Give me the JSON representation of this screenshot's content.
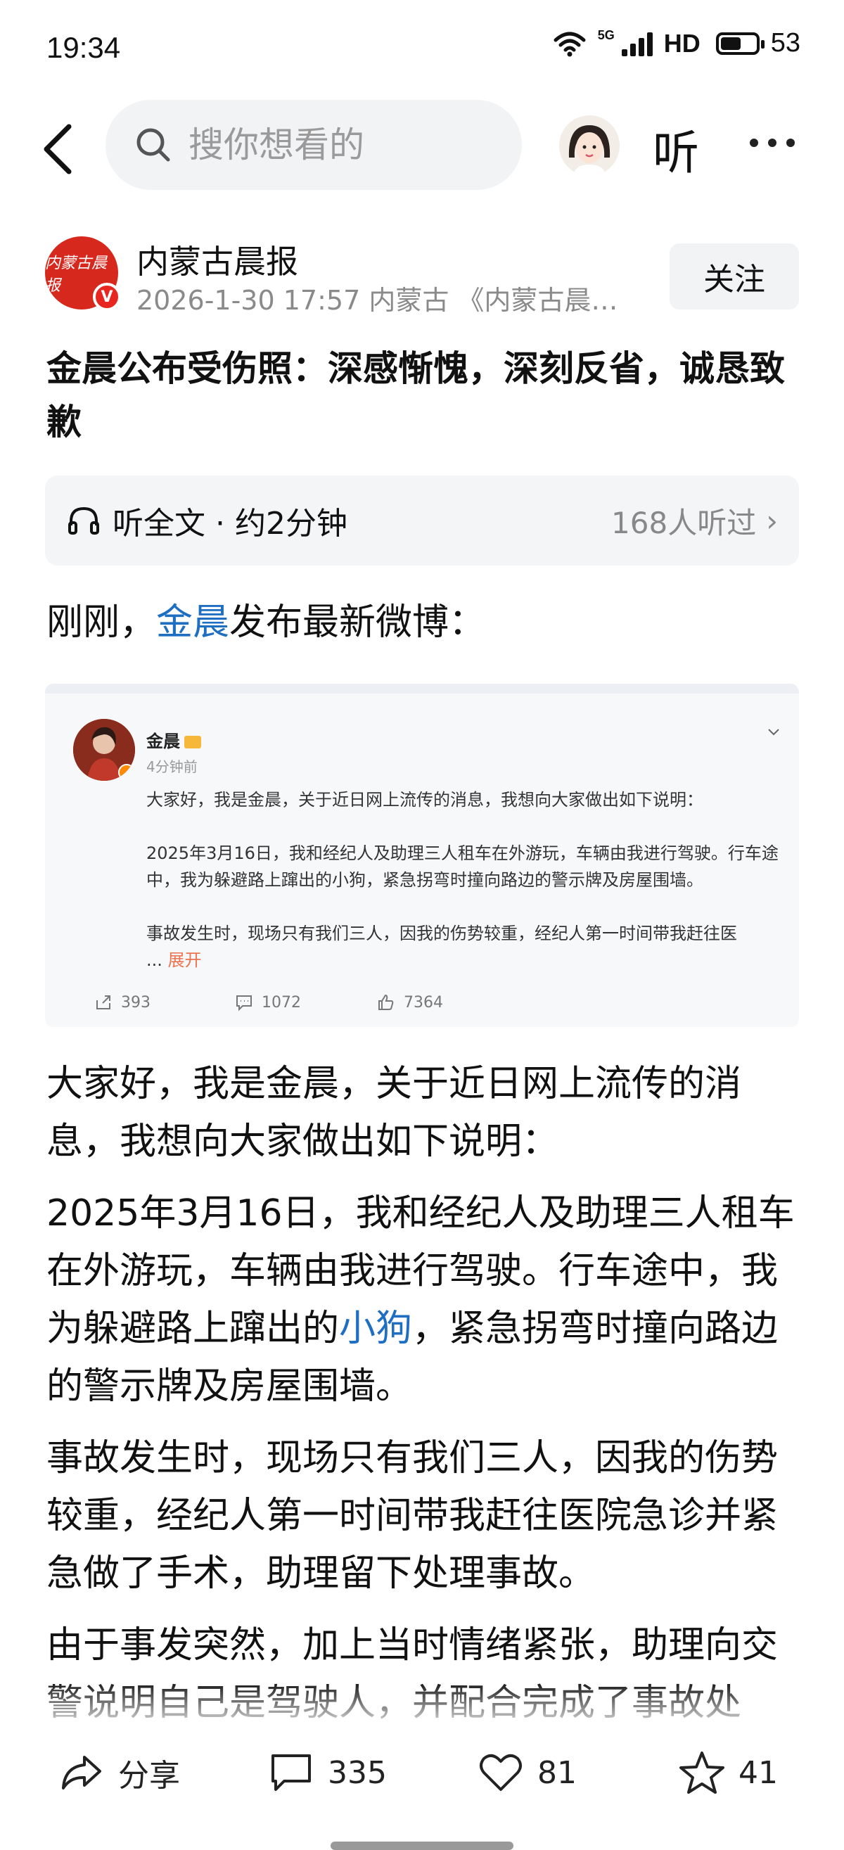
{
  "status_bar": {
    "time": "19:34",
    "network": "5G",
    "hd": "HD",
    "battery": "53",
    "battery_level_percent": 53,
    "icons": [
      "wifi-icon",
      "signal-icon",
      "battery-icon"
    ]
  },
  "nav": {
    "back_icon": "chevron-left-icon",
    "search_placeholder": "搜你想看的",
    "listen_label": "听",
    "more_icon": "more-dots-icon"
  },
  "author": {
    "name": "内蒙古晨报",
    "logo_text": "内蒙古晨报",
    "verified_mark": "V",
    "meta": "2026-1-30  17:57  内蒙古  《内蒙古晨报…",
    "follow_label": "关注"
  },
  "article": {
    "title": "金晨公布受伤照：深感惭愧，深刻反省，诚恳致歉",
    "listen_bar": {
      "label": "听全文 · 约2分钟",
      "count": "168人听过",
      "chevron": "›"
    },
    "intro_prefix": "刚刚，",
    "intro_link": "金晨",
    "intro_suffix": "发布最新微博：",
    "paragraph_1": "大家好，我是金晨，关于近日网上流传的消息，我想向大家做出如下说明：",
    "paragraph_2_before": "2025年3月16日，我和经纪人及助理三人租车在外游玩，车辆由我进行驾驶。行车途中，我为躲避路上蹿出的",
    "paragraph_2_link": "小狗",
    "paragraph_2_after": "，紧急拐弯时撞向路边的警示牌及房屋围墙。",
    "paragraph_3": "事故发生时，现场只有我们三人，因我的伤势较重，经纪人第一时间带我赶往医院急诊并紧急做了手术，助理留下处理事故。",
    "paragraph_4": "由于事发突然，加上当时情绪紧张，助理向交警说明自己是驾驶人，并配合完成了事故处"
  },
  "weibo_card": {
    "name": "金晨",
    "time": "4分钟前",
    "line_1": "大家好，我是金晨，关于近日网上流传的消息，我想向大家做出如下说明：",
    "line_2": "2025年3月16日，我和经纪人及助理三人租车在外游玩，车辆由我进行驾驶。行车途中，我为躲避路上蹿出的小狗，紧急拐弯时撞向路边的警示牌及房屋围墙。",
    "line_3": "事故发生时，现场只有我们三人，因我的伤势较重，经纪人第一时间带我赶往医",
    "ellipsis": "...",
    "expand": "展开",
    "shares": "393",
    "comments": "1072",
    "likes": "7364"
  },
  "bottom_bar": {
    "share_label": "分享",
    "comments": "335",
    "likes": "81",
    "favorites": "41"
  }
}
